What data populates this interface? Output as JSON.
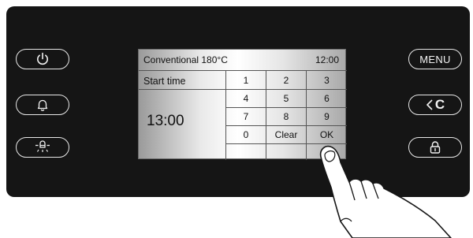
{
  "screen": {
    "mode_label": "Conventional 180°C",
    "clock": "12:00",
    "start_time_label": "Start time",
    "start_time_value": "13:00",
    "keypad": [
      "1",
      "2",
      "3",
      "4",
      "5",
      "6",
      "7",
      "8",
      "9",
      "0",
      "Clear",
      "OK"
    ]
  },
  "left_buttons": [
    {
      "icon": "power-icon"
    },
    {
      "icon": "bell-icon"
    },
    {
      "icon": "oven-light-icon"
    }
  ],
  "right_buttons": {
    "menu_label": "MENU",
    "back_label": "C",
    "lock_icon": "lock-icon"
  },
  "colors": {
    "panel": "#151515",
    "button_outline": "#e8e8e8"
  }
}
